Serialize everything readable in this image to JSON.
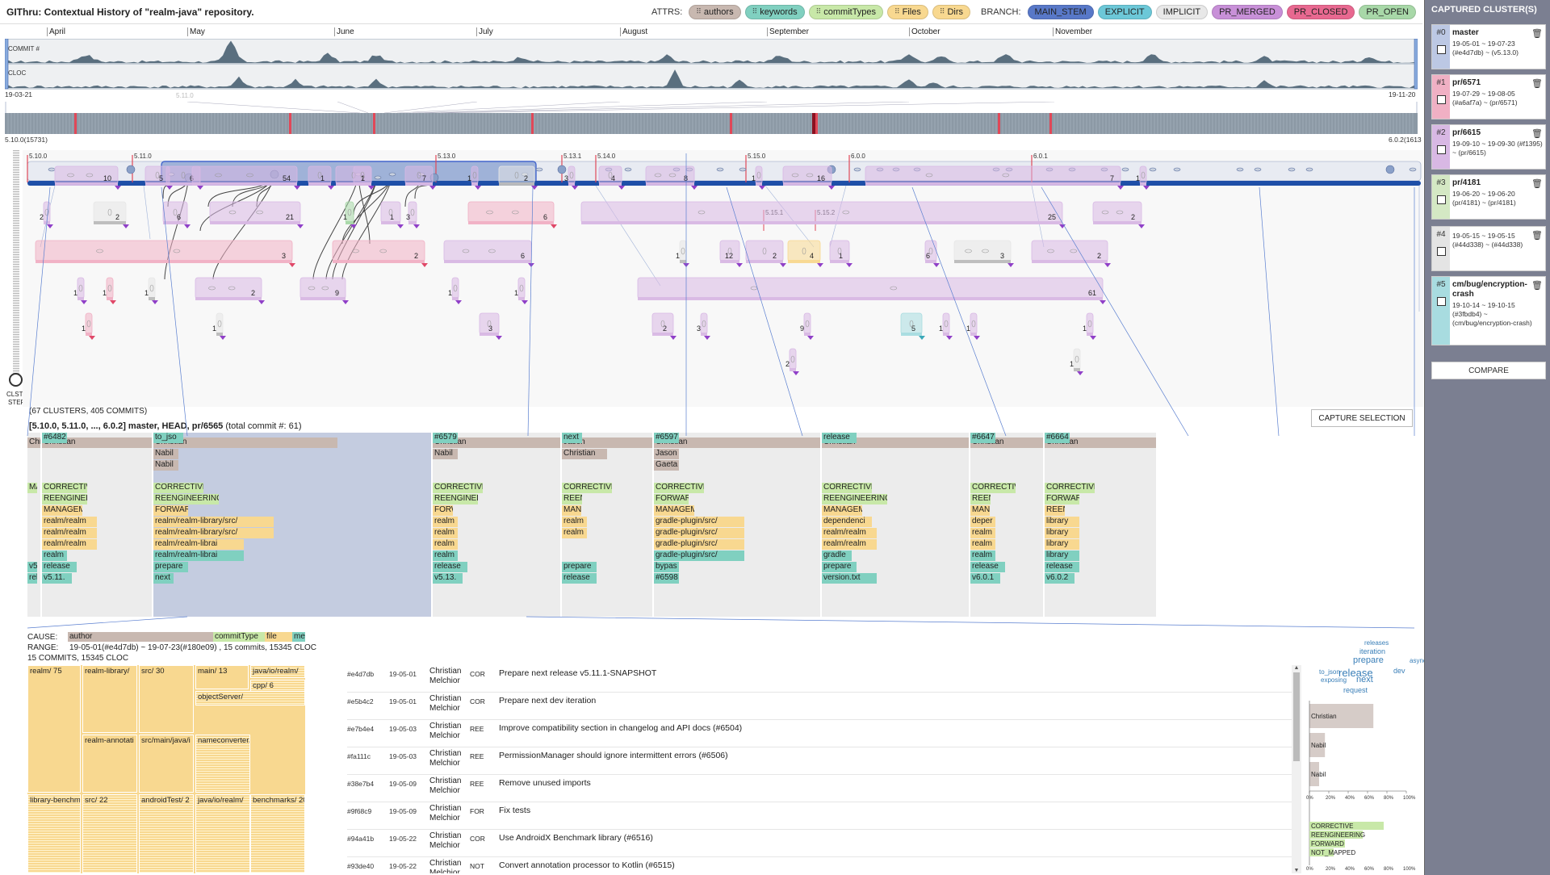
{
  "app": {
    "title": "GIThru: Contextual History of \"realm-java\" repository."
  },
  "attrs": {
    "label": "ATTRS:",
    "items": [
      {
        "label": "authors",
        "color": "#c8b8b0"
      },
      {
        "label": "keywords",
        "color": "#80d0c0"
      },
      {
        "label": "commitTypes",
        "color": "#c8e8a8"
      },
      {
        "label": "Files",
        "color": "#f8d890"
      },
      {
        "label": "Dirs",
        "color": "#f8d890"
      }
    ]
  },
  "branch": {
    "label": "BRANCH:",
    "items": [
      {
        "label": "MAIN_STEM",
        "color": "#5878c8"
      },
      {
        "label": "EXPLICIT",
        "color": "#6cc8d8"
      },
      {
        "label": "IMPLICIT",
        "color": "#e8e8e8"
      },
      {
        "label": "PR_MERGED",
        "color": "#c890d8"
      },
      {
        "label": "PR_CLOSED",
        "color": "#e86890"
      },
      {
        "label": "PR_OPEN",
        "color": "#a8d8a8"
      }
    ]
  },
  "overview": {
    "months": [
      "April",
      "May",
      "June",
      "July",
      "August",
      "September",
      "October",
      "November"
    ],
    "row_labels": [
      "COMMIT #",
      "CLOC"
    ],
    "range_start": "19-03-21",
    "range_end": "19-11-20",
    "marker": "5.11.0",
    "version_start": "5.10.0(15731)",
    "version_end": "6.0.2(1613"
  },
  "slider": {
    "label1": "CLSTR",
    "label2": "STEP"
  },
  "graph": {
    "tags": [
      "5.10.0",
      "5.11.0",
      "5.13.0",
      "5.13.1",
      "5.14.0",
      "5.15.0",
      "6.0.0",
      "6.0.1"
    ],
    "branch_tags": [
      "5.15.1",
      "5.15.2"
    ]
  },
  "summary": {
    "clusters_line": "(67 CLUSTERS, 405 COMMITS)",
    "selection_line": "[5.10.0, 5.11.0, ..., 6.0.2] master, HEAD, pr/6565",
    "total_line": "(total commit #: 61)",
    "capture_btn": "CAPTURE SELECTION"
  },
  "summary_columns": [
    {
      "author": "Chris",
      "items": [
        "",
        "",
        "",
        "MAN",
        "",
        "",
        "",
        "",
        "",
        "",
        "v5.10",
        "relea"
      ]
    },
    {
      "author": "Christian",
      "items": [
        "",
        "",
        "",
        "CORRECTIV",
        "REENGINEE",
        "MANAGEMI",
        "realm/realm",
        "realm/realm",
        "realm/realm",
        "realm",
        "release",
        "v5.11.",
        "#6482"
      ]
    },
    {
      "author": "Christian",
      "items": [
        "Nabil",
        "Nabil",
        "",
        "CORRECTIVE",
        "REENGINEERING",
        "FORWARD",
        "realm/realm-library/src/",
        "realm/realm-library/src/",
        "realm/realm-librai",
        "realm/realm-librai",
        "prepare",
        "next",
        "to_jso"
      ]
    },
    {
      "author": "Christian",
      "items": [
        "Nabil",
        "",
        "",
        "CORRECTIVE",
        "REENGINEE",
        "FORW",
        "realm",
        "realm",
        "realm",
        "realm",
        "release",
        "v5.13.",
        "#6579"
      ]
    },
    {
      "author": "Jason",
      "items": [
        "Christian",
        "",
        "",
        "CORRECTIVE",
        "REEN",
        "MAN",
        "realm",
        "realm",
        "",
        "",
        "prepare",
        "release",
        "next"
      ]
    },
    {
      "author": "Christian",
      "items": [
        "Jason",
        "Gaeta",
        "",
        "CORRECTIVE",
        "FORWARD",
        "MANAGEMI",
        "gradle-plugin/src/",
        "gradle-plugin/src/",
        "gradle-plugin/src/",
        "gradle-plugin/src/",
        "bypas",
        "#6598",
        "#6597"
      ]
    },
    {
      "author": "Christian",
      "items": [
        "",
        "",
        "",
        "CORRECTIVE",
        "REENGINEERING",
        "MANAGEMI",
        "dependenci",
        "realm/realm",
        "realm/realm",
        "gradle",
        "prepare",
        "version.txt",
        "release"
      ]
    },
    {
      "author": "Christian",
      "items": [
        "",
        "",
        "",
        "CORRECTIV",
        "REEN",
        "MAN",
        "deper",
        "realm",
        "realm",
        "realm",
        "release",
        "v6.0.1",
        "#6647"
      ]
    },
    {
      "author": "Christian",
      "items": [
        "",
        "",
        "",
        "CORRECTIVE",
        "FORWARD",
        "REEN",
        "library",
        "library",
        "library",
        "library",
        "release",
        "v6.0.2",
        "#6664"
      ]
    }
  ],
  "detail": {
    "cause_label": "CAUSE:",
    "cause_items": [
      "author",
      "commitType",
      "file",
      "me"
    ],
    "range_label": "RANGE:",
    "range_value": "19-05-01(#e4d7db) ~ 19-07-23(#180e09) , 15 commits, 15345 CLOC",
    "count_line": "15 COMMITS, 15345 CLOC"
  },
  "treemap": [
    {
      "label": "realm/ 75"
    },
    {
      "label": "realm-library/"
    },
    {
      "label": "src/ 30"
    },
    {
      "label": "main/ 13"
    },
    {
      "label": "java/io/realm/"
    },
    {
      "label": "cpp/ 6"
    },
    {
      "label": "objectServer/"
    },
    {
      "label": "realm-annotati"
    },
    {
      "label": "src/main/java/i"
    },
    {
      "label": "nameconverter/"
    },
    {
      "label": "library-benchm"
    },
    {
      "label": "src/ 22"
    },
    {
      "label": "androidTest/ 2"
    },
    {
      "label": "java/io/realm/"
    },
    {
      "label": "benchmarks/ 20"
    }
  ],
  "commits": [
    {
      "hash": "#e4d7db",
      "date": "19-05-01",
      "author": "Christian Melchior",
      "type": "COR",
      "msg": "Prepare next release v5.11.1-SNAPSHOT"
    },
    {
      "hash": "#e5b4c2",
      "date": "19-05-01",
      "author": "Christian Melchior",
      "type": "COR",
      "msg": "Prepare next dev iteration"
    },
    {
      "hash": "#e7b4e4",
      "date": "19-05-03",
      "author": "Christian Melchior",
      "type": "REE",
      "msg": "Improve compatibility section in changelog and API docs (#6504)"
    },
    {
      "hash": "#fa111c",
      "date": "19-05-03",
      "author": "Christian Melchior",
      "type": "REE",
      "msg": "PermissionManager should ignore intermittent errors (#6506)"
    },
    {
      "hash": "#38e7b4",
      "date": "19-05-09",
      "author": "Christian Melchior",
      "type": "REE",
      "msg": "Remove unused imports"
    },
    {
      "hash": "#9f68c9",
      "date": "19-05-09",
      "author": "Christian Melchior",
      "type": "FOR",
      "msg": "Fix tests"
    },
    {
      "hash": "#94a41b",
      "date": "19-05-22",
      "author": "Christian Melchior",
      "type": "COR",
      "msg": "Use AndroidX Benchmark library (#6516)"
    },
    {
      "hash": "#93de40",
      "date": "19-05-22",
      "author": "Christian Melchior",
      "type": "NOT",
      "msg": "Convert annotation processor to Kotlin (#6515)"
    }
  ],
  "wordcloud": [
    "releases",
    "iteration",
    "prepare",
    "asynccopen",
    "to_json",
    "release",
    "dev",
    "exposing",
    "next",
    "request"
  ],
  "barchart": {
    "authors": [
      "Christian",
      "Nabil",
      "Nabil"
    ],
    "author_values": [
      66,
      16,
      10
    ],
    "ticks": [
      "0%",
      "20%",
      "40%",
      "60%",
      "80%",
      "100%"
    ],
    "types": [
      "CORRECTIVE",
      "REENGINEERING",
      "FORWARD",
      "NOT_MAPPED"
    ]
  },
  "captured": {
    "title": "CAPTURED CLUSTER(S)",
    "compare": "COMPARE",
    "items": [
      {
        "idx": "#0",
        "name": "master",
        "info": "19-05-01 ~ 19-07-23 (#e4d7db) ~ (v5.13.0)",
        "color": "#bcc8e4"
      },
      {
        "idx": "#1",
        "name": "pr/6571",
        "info": "19-07-29 ~ 19-08-05 (#a6af7a) ~ (pr/6571)",
        "color": "#f0b0c4"
      },
      {
        "idx": "#2",
        "name": "pr/6615",
        "info": "19-09-10 ~ 19-09-30 (#f1395) ~ (pr/6615)",
        "color": "#d8b8e4"
      },
      {
        "idx": "#3",
        "name": "pr/4181",
        "info": "19-06-20 ~ 19-06-20 (pr/4181) ~ (pr/4181)",
        "color": "#d4e8c4"
      },
      {
        "idx": "#4",
        "name": "",
        "info": "19-05-15 ~ 19-05-15 (#44d338) ~ (#44d338)",
        "color": "#e4e4e4"
      },
      {
        "idx": "#5",
        "name": "cm/bug/encryption-crash",
        "info": "19-10-14 ~ 19-10-15 (#3fbdb4) ~ (cm/bug/encryption-crash)",
        "color": "#a8dce0"
      }
    ]
  }
}
